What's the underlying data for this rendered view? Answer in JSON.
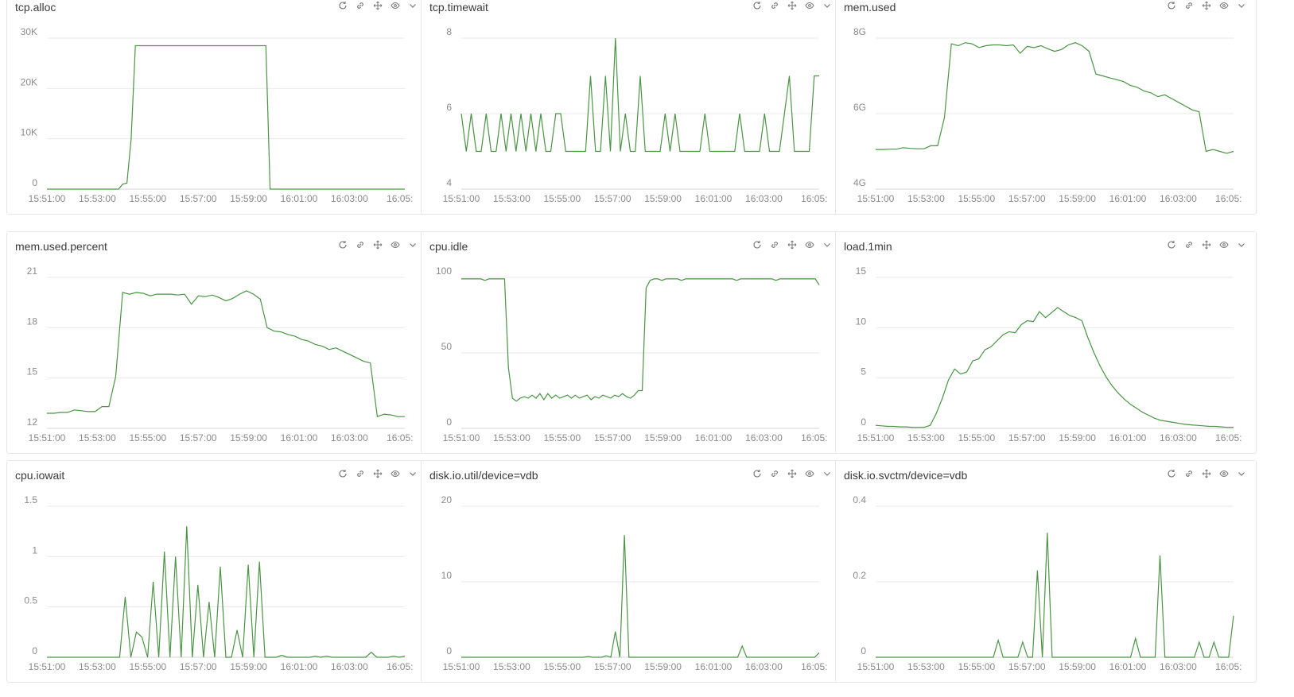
{
  "colors": {
    "series": "#4a9444",
    "grid": "#e9e9e9",
    "text": "#8a8a8a"
  },
  "panel_actions": [
    "refresh-icon",
    "link-icon",
    "move-icon",
    "eye-icon",
    "chevron-down-icon"
  ],
  "panels": [
    {
      "title": "tcp.alloc",
      "chart_data": {
        "type": "line",
        "xlabel": "",
        "ylabel": "",
        "x_ticks": [
          "15:51:00",
          "15:53:00",
          "15:55:00",
          "15:57:00",
          "15:59:00",
          "16:01:00",
          "16:03:00",
          "16:05:"
        ],
        "y_ticks": [
          "30K",
          "20K",
          "10K",
          "0"
        ],
        "ylim": [
          0,
          30000
        ],
        "series": [
          {
            "values": [
              0,
              0,
              0,
              0,
              0,
              0,
              0,
              0,
              0,
              0,
              0,
              0,
              0,
              0,
              0,
              0,
              0,
              0,
              1000,
              1200,
              10000,
              28500,
              28500,
              28500,
              28500,
              28500,
              28500,
              28500,
              28500,
              28500,
              28500,
              28500,
              28500,
              28500,
              28500,
              28500,
              28500,
              28500,
              28500,
              28500,
              28500,
              28500,
              28500,
              28500,
              28500,
              28500,
              28500,
              28500,
              28500,
              28500,
              28500,
              28500,
              28500,
              0,
              0,
              0,
              0,
              0,
              0,
              0,
              0,
              0,
              0,
              0,
              0,
              0,
              0,
              0,
              0,
              0,
              0,
              0,
              0,
              0,
              0,
              0,
              0,
              0,
              0,
              0,
              0,
              0,
              0,
              0,
              0,
              0
            ]
          }
        ]
      }
    },
    {
      "title": "tcp.timewait",
      "chart_data": {
        "type": "line",
        "xlabel": "",
        "ylabel": "",
        "x_ticks": [
          "15:51:00",
          "15:53:00",
          "15:55:00",
          "15:57:00",
          "15:59:00",
          "16:01:00",
          "16:03:00",
          "16:05:"
        ],
        "y_ticks": [
          "8",
          "6",
          "4"
        ],
        "ylim": [
          4,
          8
        ],
        "series": [
          {
            "values": [
              6,
              5,
              6,
              5,
              5,
              6,
              5,
              5,
              6,
              5,
              6,
              5,
              6,
              5,
              6,
              5,
              6,
              5,
              5,
              6,
              6,
              5,
              5,
              5,
              5,
              5,
              7,
              5,
              5,
              7,
              5,
              8,
              5,
              6,
              5,
              5,
              7,
              5,
              5,
              5,
              5,
              6,
              5,
              6,
              5,
              5,
              5,
              5,
              5,
              6,
              5,
              5,
              5,
              5,
              5,
              5,
              6,
              5,
              5,
              5,
              5,
              6,
              5,
              5,
              5,
              6,
              7,
              5,
              5,
              5,
              5,
              7,
              7
            ]
          }
        ]
      }
    },
    {
      "title": "mem.used",
      "chart_data": {
        "type": "line",
        "xlabel": "",
        "ylabel": "",
        "x_ticks": [
          "15:51:00",
          "15:53:00",
          "15:55:00",
          "15:57:00",
          "15:59:00",
          "16:01:00",
          "16:03:00",
          "16:05:"
        ],
        "y_ticks": [
          "8G",
          "6G",
          "4G"
        ],
        "ylim": [
          4,
          8
        ],
        "series": [
          {
            "values": [
              5.05,
              5.05,
              5.06,
              5.06,
              5.1,
              5.08,
              5.07,
              5.07,
              5.15,
              5.15,
              5.9,
              7.85,
              7.8,
              7.88,
              7.85,
              7.75,
              7.8,
              7.82,
              7.82,
              7.8,
              7.82,
              7.6,
              7.78,
              7.75,
              7.8,
              7.72,
              7.65,
              7.7,
              7.82,
              7.88,
              7.8,
              7.65,
              7.05,
              7.0,
              6.95,
              6.9,
              6.85,
              6.75,
              6.7,
              6.6,
              6.55,
              6.45,
              6.5,
              6.4,
              6.3,
              6.2,
              6.1,
              6.05,
              5.0,
              5.05,
              5.0,
              4.95,
              5.0
            ]
          }
        ]
      }
    },
    {
      "title": "mem.used.percent",
      "chart_data": {
        "type": "line",
        "xlabel": "",
        "ylabel": "",
        "x_ticks": [
          "15:51:00",
          "15:53:00",
          "15:55:00",
          "15:57:00",
          "15:59:00",
          "16:01:00",
          "16:03:00",
          "16:05:"
        ],
        "y_ticks": [
          "21",
          "18",
          "15",
          "12"
        ],
        "ylim": [
          12,
          21
        ],
        "series": [
          {
            "values": [
              12.9,
              12.9,
              12.95,
              12.95,
              13.1,
              13.05,
              13.0,
              13.0,
              13.3,
              13.3,
              15.1,
              20.1,
              20.0,
              20.1,
              20.05,
              19.9,
              20.0,
              20.0,
              20.0,
              19.95,
              20.0,
              19.4,
              19.9,
              19.85,
              19.95,
              19.8,
              19.6,
              19.75,
              20.0,
              20.2,
              20.0,
              19.7,
              18.0,
              17.8,
              17.75,
              17.6,
              17.5,
              17.3,
              17.2,
              17.0,
              16.9,
              16.7,
              16.8,
              16.6,
              16.4,
              16.2,
              16.0,
              15.9,
              12.7,
              12.85,
              12.8,
              12.7,
              12.7
            ]
          }
        ]
      }
    },
    {
      "title": "cpu.idle",
      "chart_data": {
        "type": "line",
        "xlabel": "",
        "ylabel": "",
        "x_ticks": [
          "15:51:00",
          "15:53:00",
          "15:55:00",
          "15:57:00",
          "15:59:00",
          "16:01:00",
          "16:03:00",
          "16:05:"
        ],
        "y_ticks": [
          "100",
          "50",
          "0"
        ],
        "ylim": [
          0,
          100
        ],
        "series": [
          {
            "values": [
              99,
              99,
              99,
              99,
              99,
              99,
              98,
              99,
              99,
              99,
              99,
              99,
              40,
              20,
              18,
              20,
              21,
              20,
              22,
              20,
              23,
              19,
              23,
              20,
              22,
              20,
              21,
              22,
              20,
              22,
              20,
              21,
              22,
              19,
              21,
              20,
              22,
              21,
              20,
              22,
              21,
              23,
              21,
              20,
              22,
              25,
              25,
              93,
              98,
              99,
              99,
              98,
              99,
              99,
              99,
              99,
              98,
              99,
              99,
              99,
              99,
              99,
              99,
              99,
              99,
              99,
              99,
              99,
              99,
              99,
              98,
              99,
              99,
              99,
              99,
              99,
              99,
              99,
              99,
              99,
              98,
              99,
              99,
              99,
              99,
              99,
              99,
              99,
              99,
              99,
              99,
              95
            ]
          }
        ]
      }
    },
    {
      "title": "load.1min",
      "chart_data": {
        "type": "line",
        "xlabel": "",
        "ylabel": "",
        "x_ticks": [
          "15:51:00",
          "15:53:00",
          "15:55:00",
          "15:57:00",
          "15:59:00",
          "16:01:00",
          "16:03:00",
          "16:05:"
        ],
        "y_ticks": [
          "15",
          "10",
          "5",
          "0"
        ],
        "ylim": [
          0,
          15
        ],
        "series": [
          {
            "values": [
              0.3,
              0.25,
              0.2,
              0.2,
              0.15,
              0.15,
              0.1,
              0.1,
              0.1,
              0.3,
              1.5,
              3.0,
              4.8,
              5.9,
              5.4,
              5.6,
              6.7,
              6.9,
              7.8,
              8.1,
              8.7,
              9.3,
              9.6,
              9.5,
              10.3,
              10.7,
              10.6,
              11.6,
              11.0,
              11.5,
              12.0,
              11.6,
              11.2,
              11.0,
              10.7,
              9.0,
              7.5,
              6.2,
              5.1,
              4.2,
              3.5,
              2.9,
              2.4,
              2.0,
              1.6,
              1.3,
              1.0,
              0.8,
              0.7,
              0.6,
              0.5,
              0.4,
              0.35,
              0.3,
              0.25,
              0.2,
              0.2,
              0.15,
              0.1,
              0.1
            ]
          }
        ]
      }
    },
    {
      "title": "cpu.iowait",
      "chart_data": {
        "type": "line",
        "xlabel": "",
        "ylabel": "",
        "x_ticks": [
          "15:51:00",
          "15:53:00",
          "15:55:00",
          "15:57:00",
          "15:59:00",
          "16:01:00",
          "16:03:00",
          "16:05:"
        ],
        "y_ticks": [
          "1.5",
          "1",
          "0.5",
          "0"
        ],
        "ylim": [
          0,
          1.5
        ],
        "series": [
          {
            "values": [
              0,
              0,
              0,
              0,
              0,
              0,
              0,
              0,
              0,
              0,
              0,
              0,
              0,
              0,
              0.6,
              0,
              0.25,
              0.2,
              0,
              0.75,
              0,
              1.05,
              0,
              1.0,
              0,
              1.3,
              0,
              0.72,
              0,
              0.55,
              0,
              0.9,
              0,
              0,
              0.27,
              0,
              0.92,
              0,
              0.95,
              0,
              0,
              0,
              0.02,
              0,
              0,
              0,
              0,
              0,
              0.01,
              0,
              0.01,
              0,
              0,
              0,
              0,
              0,
              0,
              0,
              0.05,
              0,
              0,
              0,
              0.01,
              0,
              0.01
            ]
          }
        ]
      }
    },
    {
      "title": "disk.io.util/device=vdb",
      "chart_data": {
        "type": "line",
        "xlabel": "",
        "ylabel": "",
        "x_ticks": [
          "15:51:00",
          "15:53:00",
          "15:55:00",
          "15:57:00",
          "15:59:00",
          "16:01:00",
          "16:03:00",
          "16:05:"
        ],
        "y_ticks": [
          "20",
          "10",
          "0"
        ],
        "ylim": [
          0,
          20
        ],
        "series": [
          {
            "values": [
              0,
              0,
              0,
              0,
              0,
              0,
              0,
              0,
              0,
              0,
              0,
              0,
              0,
              0,
              0,
              0,
              0,
              0,
              0,
              0,
              0,
              0,
              0,
              0,
              0,
              0,
              0,
              0,
              0.1,
              0,
              0,
              0,
              0.2,
              0,
              3.4,
              0,
              16.2,
              0,
              0,
              0,
              0,
              0,
              0,
              0,
              0,
              0,
              0,
              0,
              0,
              0,
              0,
              0,
              0,
              0,
              0,
              0,
              0,
              0,
              0,
              0,
              0,
              0,
              1.5,
              0,
              0,
              0,
              0,
              0,
              0,
              0,
              0,
              0,
              0,
              0,
              0,
              0,
              0,
              0,
              0,
              0.6
            ]
          }
        ]
      }
    },
    {
      "title": "disk.io.svctm/device=vdb",
      "chart_data": {
        "type": "line",
        "xlabel": "",
        "ylabel": "",
        "x_ticks": [
          "15:51:00",
          "15:53:00",
          "15:55:00",
          "15:57:00",
          "15:59:00",
          "16:01:00",
          "16:03:00",
          "16:05:"
        ],
        "y_ticks": [
          "0.4",
          "0.2",
          "0"
        ],
        "ylim": [
          0,
          0.4
        ],
        "series": [
          {
            "values": [
              0,
              0,
              0,
              0,
              0,
              0,
              0,
              0,
              0,
              0,
              0,
              0,
              0,
              0,
              0,
              0,
              0,
              0,
              0,
              0,
              0,
              0,
              0,
              0,
              0,
              0.045,
              0,
              0,
              0,
              0,
              0.04,
              0,
              0,
              0.23,
              0,
              0.33,
              0,
              0,
              0,
              0,
              0,
              0,
              0,
              0,
              0,
              0,
              0,
              0,
              0,
              0,
              0,
              0,
              0,
              0.05,
              0,
              0,
              0,
              0,
              0.27,
              0,
              0,
              0,
              0,
              0,
              0,
              0,
              0.04,
              0,
              0,
              0.04,
              0,
              0,
              0,
              0.11
            ]
          }
        ]
      }
    }
  ]
}
